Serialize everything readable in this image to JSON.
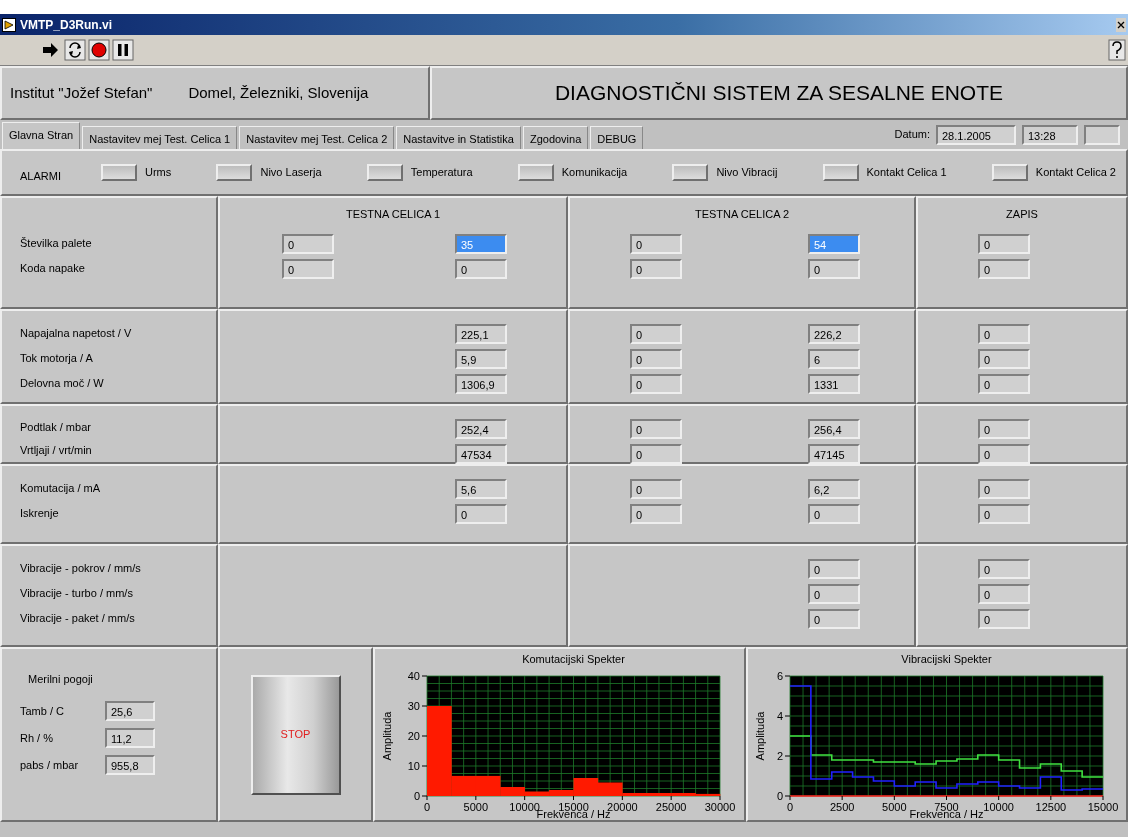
{
  "window": {
    "title": "VMTP_D3Run.vi"
  },
  "header": {
    "institute": "Institut \"Jožef Stefan\"",
    "company": "Domel, Železniki, Slovenija",
    "title": "DIAGNOSTIČNI SISTEM ZA SESALNE ENOTE"
  },
  "tabs": [
    {
      "label": "Glavna Stran",
      "selected": true
    },
    {
      "label": "Nastavitev mej Test. Celica 1",
      "selected": false
    },
    {
      "label": "Nastavitev mej Test. Celica 2",
      "selected": false
    },
    {
      "label": "Nastavitve in Statistika",
      "selected": false
    },
    {
      "label": "Zgodovina",
      "selected": false
    },
    {
      "label": "DEBUG",
      "selected": false
    }
  ],
  "datum": {
    "label": "Datum:",
    "date": "28.1.2005",
    "time": "13:28"
  },
  "alarms": {
    "label": "ALARMI",
    "items": [
      {
        "label": "Urms",
        "on": false
      },
      {
        "label": "Nivo Laserja",
        "on": false
      },
      {
        "label": "Temperatura",
        "on": false
      },
      {
        "label": "Komunikacija",
        "on": false
      },
      {
        "label": "Nivo Vibracij",
        "on": false
      },
      {
        "label": "Kontakt Celica 1",
        "on": false
      },
      {
        "label": "Kontakt  Celica 2",
        "on": false
      }
    ]
  },
  "table": {
    "columns": [
      "TESTNA CELICA 1",
      "TESTNA CELICA 2",
      "ZAPIS"
    ],
    "sections": [
      {
        "rows": [
          {
            "label": "Številka palete",
            "cells": [
              {
                "value": "0",
                "selected": false
              },
              {
                "value": "35",
                "selected": true
              },
              {
                "value": "0",
                "selected": false
              },
              {
                "value": "54",
                "selected": true
              },
              {
                "value": "0",
                "selected": false
              }
            ]
          },
          {
            "label": "Koda napake",
            "cells": [
              {
                "value": "0",
                "selected": false
              },
              {
                "value": "0",
                "selected": false
              },
              {
                "value": "0",
                "selected": false
              },
              {
                "value": "0",
                "selected": false
              },
              {
                "value": "0",
                "selected": false
              }
            ]
          }
        ]
      },
      {
        "rows": [
          {
            "label": "Napajalna napetost  / V",
            "cells": [
              null,
              {
                "value": "225,1",
                "selected": false
              },
              {
                "value": "0",
                "selected": false
              },
              {
                "value": "226,2",
                "selected": false
              },
              {
                "value": "0",
                "selected": false
              }
            ]
          },
          {
            "label": "Tok motorja  / A",
            "cells": [
              null,
              {
                "value": "5,9",
                "selected": false
              },
              {
                "value": "0",
                "selected": false
              },
              {
                "value": "6",
                "selected": false
              },
              {
                "value": "0",
                "selected": false
              }
            ]
          },
          {
            "label": "Delovna moč  / W",
            "cells": [
              null,
              {
                "value": "1306,9",
                "selected": false
              },
              {
                "value": "0",
                "selected": false
              },
              {
                "value": "1331",
                "selected": false
              },
              {
                "value": "0",
                "selected": false
              }
            ]
          }
        ]
      },
      {
        "rows": [
          {
            "label": "Podtlak  / mbar",
            "cells": [
              null,
              {
                "value": "252,4",
                "selected": false
              },
              {
                "value": "0",
                "selected": false
              },
              {
                "value": "256,4",
                "selected": false
              },
              {
                "value": "0",
                "selected": false
              }
            ]
          },
          {
            "label": "Vrtljaji  / vrt/min",
            "cells": [
              null,
              {
                "value": "47534",
                "selected": false
              },
              {
                "value": "0",
                "selected": false
              },
              {
                "value": "47145",
                "selected": false
              },
              {
                "value": "0",
                "selected": false
              }
            ]
          }
        ]
      },
      {
        "rows": [
          {
            "label": "Komutacija  / mA",
            "cells": [
              null,
              {
                "value": "5,6",
                "selected": false
              },
              {
                "value": "0",
                "selected": false
              },
              {
                "value": "6,2",
                "selected": false
              },
              {
                "value": "0",
                "selected": false
              }
            ]
          },
          {
            "label": "Iskrenje",
            "cells": [
              null,
              {
                "value": "0",
                "selected": false
              },
              {
                "value": "0",
                "selected": false
              },
              {
                "value": "0",
                "selected": false
              },
              {
                "value": "0",
                "selected": false
              }
            ]
          }
        ]
      },
      {
        "rows": [
          {
            "label": "Vibracije - pokrov  / mm/s",
            "cells": [
              null,
              null,
              null,
              {
                "value": "0",
                "selected": false
              },
              {
                "value": "0",
                "selected": false
              }
            ]
          },
          {
            "label": "Vibracije - turbo  / mm/s",
            "cells": [
              null,
              null,
              null,
              {
                "value": "0",
                "selected": false
              },
              {
                "value": "0",
                "selected": false
              }
            ]
          },
          {
            "label": "Vibracije - paket  / mm/s",
            "cells": [
              null,
              null,
              null,
              {
                "value": "0",
                "selected": false
              },
              {
                "value": "0",
                "selected": false
              }
            ]
          }
        ]
      }
    ]
  },
  "conditions": {
    "title": "Merilni pogoji",
    "rows": [
      {
        "label": "Tamb  / C",
        "value": "25,6"
      },
      {
        "label": "Rh  / %",
        "value": "11,2"
      },
      {
        "label": "pabs  / mbar",
        "value": "955,8"
      }
    ]
  },
  "stop_button": {
    "label": "STOP"
  },
  "charts": [
    {
      "chart_data": {
        "type": "bar",
        "title": "Komutacijski Spekter",
        "xlabel": "Frekvenca /  Hz",
        "ylabel": "Amplituda",
        "x": [
          1250,
          3750,
          6250,
          8750,
          11250,
          13750,
          16250,
          18750,
          21250,
          23750,
          26250,
          28750
        ],
        "series": [
          {
            "color": "#ff1a00",
            "values": [
              30,
              6.7,
              6.7,
              3,
              1.5,
              2,
              6,
              4.5,
              1,
              1,
              1,
              0.7
            ]
          }
        ],
        "xlim": [
          0,
          30000
        ],
        "ylim": [
          0,
          40
        ],
        "grid": true,
        "xticks": [
          0,
          5000,
          10000,
          15000,
          20000,
          25000,
          30000
        ],
        "yticks": [
          0,
          10,
          20,
          30,
          40
        ]
      }
    },
    {
      "chart_data": {
        "type": "line",
        "title": "Vibracijski Spekter",
        "xlabel": "Frekvenca / Hz",
        "ylabel": "Amplituda",
        "x": [
          0,
          1000,
          1000,
          2000,
          2000,
          3000,
          3000,
          4000,
          4000,
          5000,
          5000,
          6000,
          6000,
          7000,
          7000,
          8000,
          8000,
          9000,
          9000,
          10000,
          10000,
          11000,
          11000,
          12000,
          12000,
          13000,
          13000,
          14000,
          14000,
          15000
        ],
        "series": [
          {
            "color": "#40e040",
            "values": [
              3,
              3,
              2.05,
              2.05,
              1.8,
              1.8,
              1.8,
              1.8,
              1.7,
              1.7,
              1.7,
              1.7,
              1.6,
              1.6,
              1.75,
              1.75,
              1.85,
              1.85,
              2.05,
              2.05,
              1.8,
              1.8,
              1.4,
              1.4,
              1.6,
              1.6,
              1.25,
              1.25,
              0.95,
              0.95
            ]
          },
          {
            "color": "#2020ff",
            "values": [
              5.5,
              5.5,
              0.85,
              0.85,
              1.2,
              1.2,
              0.95,
              0.95,
              0.75,
              0.75,
              0.5,
              0.5,
              0.7,
              0.7,
              0.4,
              0.4,
              0.6,
              0.6,
              0.7,
              0.7,
              0.5,
              0.5,
              0.4,
              0.4,
              0.95,
              0.95,
              0.3,
              0.3,
              0.35,
              0.35
            ]
          },
          {
            "color": "#ff2020",
            "values": [
              0,
              0,
              0,
              0,
              0,
              0,
              0,
              0,
              0,
              0,
              0,
              0,
              0,
              0,
              0,
              0,
              0,
              0,
              0,
              0,
              0,
              0,
              0,
              0,
              0,
              0,
              0,
              0,
              0,
              0
            ]
          }
        ],
        "xlim": [
          0,
          15000
        ],
        "ylim": [
          0,
          6
        ],
        "grid": true,
        "xticks": [
          0,
          2500,
          5000,
          7500,
          10000,
          12500,
          15000
        ],
        "yticks": [
          0,
          2,
          4,
          6
        ]
      }
    }
  ]
}
